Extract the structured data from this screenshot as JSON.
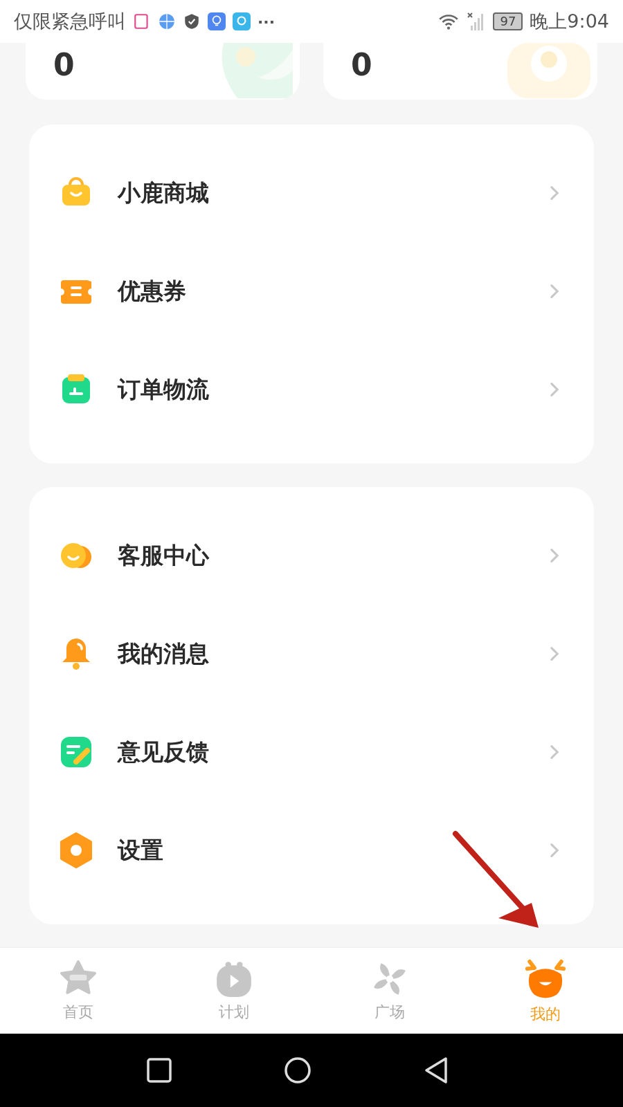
{
  "status_bar": {
    "carrier": "仅限紧急呼叫",
    "more": "···",
    "battery": "97",
    "time": "晚上9:04"
  },
  "stat_cards": [
    {
      "value": "0",
      "kind": "leaf"
    },
    {
      "value": "0",
      "kind": "flower"
    }
  ],
  "menu_groups": [
    [
      {
        "label": "小鹿商城",
        "kind": "bag"
      },
      {
        "label": "优惠券",
        "kind": "coupon"
      },
      {
        "label": "订单物流",
        "kind": "box"
      }
    ],
    [
      {
        "label": "客服中心",
        "kind": "chat"
      },
      {
        "label": "我的消息",
        "kind": "bell"
      },
      {
        "label": "意见反馈",
        "kind": "note"
      },
      {
        "label": "设置",
        "kind": "gear"
      }
    ]
  ],
  "tab_bar": [
    {
      "label": "首页",
      "kind": "star",
      "selected": false
    },
    {
      "label": "计划",
      "kind": "play",
      "selected": false
    },
    {
      "label": "广场",
      "kind": "fan",
      "selected": false
    },
    {
      "label": "我的",
      "kind": "deer",
      "selected": true
    }
  ],
  "annotation": {
    "kind": "arrow"
  }
}
